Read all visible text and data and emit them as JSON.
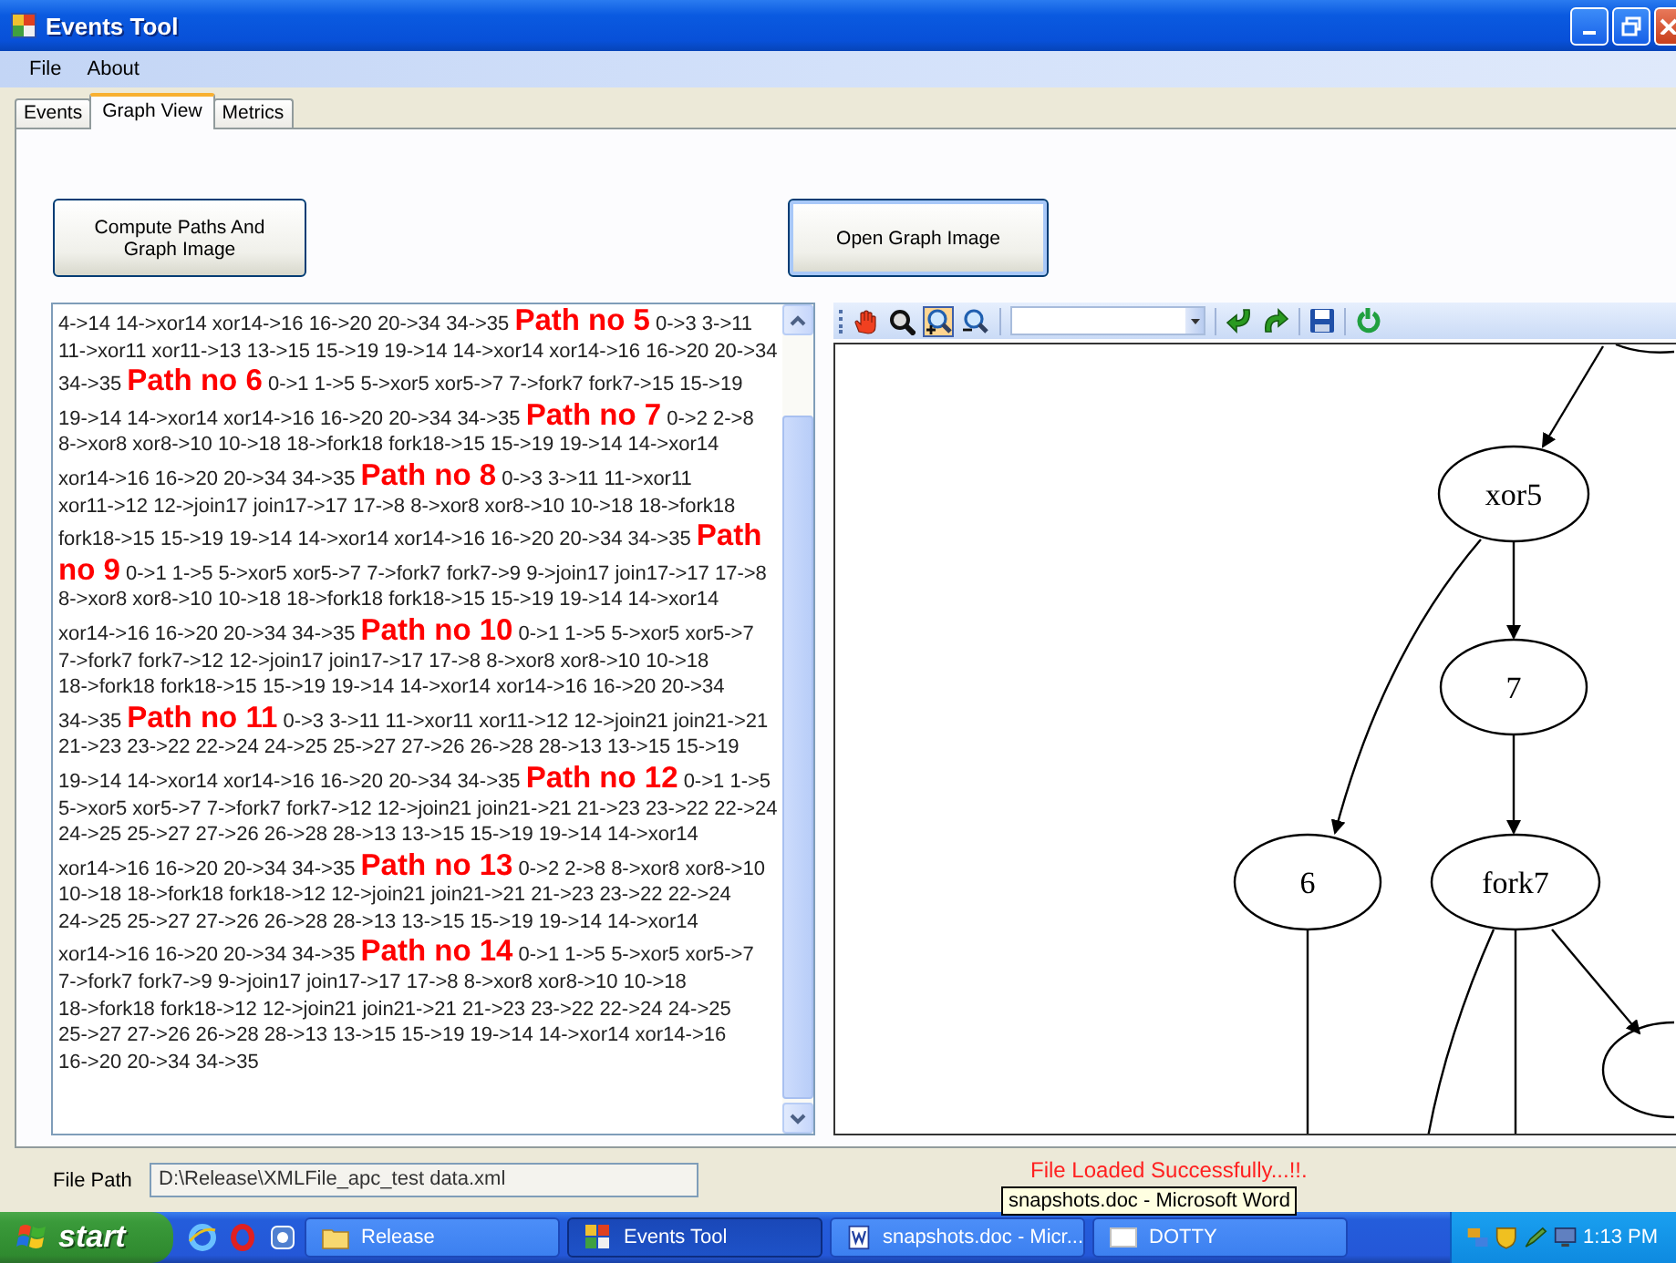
{
  "window": {
    "title": "Events Tool"
  },
  "menu": [
    "File",
    "About"
  ],
  "tabs": [
    {
      "label": "Events",
      "selected": false
    },
    {
      "label": "Graph View",
      "selected": true
    },
    {
      "label": "Metrics",
      "selected": false
    }
  ],
  "buttons": [
    "Compute Paths And Graph Image",
    "Open Graph Image"
  ],
  "paths_output": [
    {
      "kind": "steps",
      "text": "4->14 14->xor14 xor14->16 16->20 20->34 34->35"
    },
    {
      "kind": "heading",
      "text": "Path no 5"
    },
    {
      "kind": "steps",
      "text": "0->3 3->11 11->xor11 xor11->13 13->15 15->19 19->14 14->xor14 xor14->16 16->20 20->34 34->35"
    },
    {
      "kind": "heading",
      "text": "Path no 6"
    },
    {
      "kind": "steps",
      "text": "0->1 1->5 5->xor5 xor5->7 7->fork7 fork7->15 15->19 19->14 14->xor14 xor14->16 16->20 20->34 34->35"
    },
    {
      "kind": "heading",
      "text": "Path no 7"
    },
    {
      "kind": "steps",
      "text": "0->2 2->8 8->xor8 xor8->10 10->18 18->fork18 fork18->15 15->19 19->14 14->xor14 xor14->16 16->20 20->34 34->35"
    },
    {
      "kind": "heading",
      "text": "Path no 8"
    },
    {
      "kind": "steps",
      "text": "0->3 3->11 11->xor11 xor11->12 12->join17 join17->17 17->8 8->xor8 xor8->10 10->18 18->fork18 fork18->15 15->19 19->14 14->xor14 xor14->16 16->20 20->34 34->35"
    },
    {
      "kind": "heading",
      "text": "Path no 9"
    },
    {
      "kind": "steps",
      "text": "0->1 1->5 5->xor5 xor5->7 7->fork7 fork7->9 9->join17 join17->17 17->8 8->xor8 xor8->10 10->18 18->fork18 fork18->15 15->19 19->14 14->xor14 xor14->16 16->20 20->34 34->35"
    },
    {
      "kind": "heading",
      "text": "Path no 10"
    },
    {
      "kind": "steps",
      "text": "0->1 1->5 5->xor5 xor5->7 7->fork7 fork7->12 12->join17 join17->17 17->8 8->xor8 xor8->10 10->18 18->fork18 fork18->15 15->19 19->14 14->xor14 xor14->16 16->20 20->34 34->35"
    },
    {
      "kind": "heading",
      "text": "Path no 11"
    },
    {
      "kind": "steps",
      "text": "0->3 3->11 11->xor11 xor11->12 12->join21 join21->21 21->23 23->22 22->24 24->25 25->27 27->26 26->28 28->13 13->15 15->19 19->14 14->xor14 xor14->16 16->20 20->34 34->35"
    },
    {
      "kind": "heading",
      "text": "Path no 12"
    },
    {
      "kind": "steps",
      "text": "0->1 1->5 5->xor5 xor5->7 7->fork7 fork7->12 12->join21 join21->21 21->23 23->22 22->24 24->25 25->27 27->26 26->28 28->13 13->15 15->19 19->14 14->xor14 xor14->16 16->20 20->34 34->35"
    },
    {
      "kind": "heading",
      "text": "Path no 13"
    },
    {
      "kind": "steps",
      "text": "0->2 2->8 8->xor8 xor8->10 10->18 18->fork18 fork18->12 12->join21 join21->21 21->23 23->22 22->24 24->25 25->27 27->26 26->28 28->13 13->15 15->19 19->14 14->xor14 xor14->16 16->20 20->34 34->35"
    },
    {
      "kind": "heading",
      "text": "Path no 14"
    },
    {
      "kind": "steps",
      "text": "0->1 1->5 5->xor5 xor5->7 7->fork7 fork7->9 9->join17 join17->17 17->8 8->xor8 xor8->10 10->18 18->fork18 fork18->12 12->join21 join21->21 21->23 23->22 22->24 24->25 25->27 27->26 26->28 28->13 13->15 15->19 19->14 14->xor14 xor14->16 16->20 20->34 34->35"
    }
  ],
  "graph_viewer": {
    "tools": [
      {
        "selected": false
      },
      {
        "selected": false
      },
      {
        "selected": true
      },
      {
        "selected": false
      }
    ],
    "nodes": [
      {
        "label": "xor5"
      },
      {
        "label": "7"
      },
      {
        "label": "6"
      },
      {
        "label": "fork7"
      }
    ]
  },
  "file_path": {
    "label": "File Path",
    "value": "D:\\Release\\XMLFile_apc_test data.xml"
  },
  "status": "File Loaded Successfully...!!.",
  "tooltip": "snapshots.doc - Microsoft Word",
  "taskbar": {
    "start": "start",
    "tasks": [
      {
        "label": "Release",
        "selected": false
      },
      {
        "label": "Events Tool",
        "selected": true
      },
      {
        "label": "snapshots.doc - Micr...",
        "selected": false
      },
      {
        "label": "DOTTY",
        "selected": false
      }
    ],
    "clock": "1:13 PM"
  }
}
